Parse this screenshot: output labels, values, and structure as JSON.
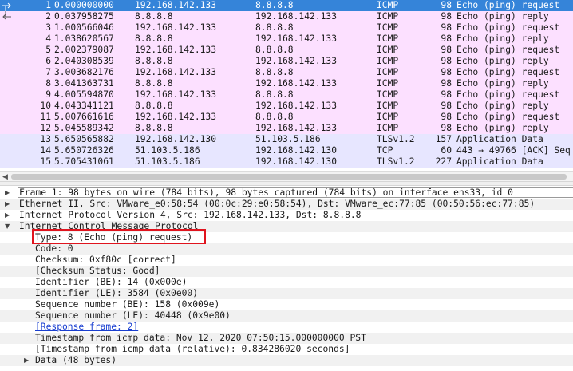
{
  "packets": [
    {
      "no": "1",
      "time": "0.000000000",
      "src": "192.168.142.133",
      "dst": "8.8.8.8",
      "proto": "ICMP",
      "len": "98",
      "info": "Echo (ping) request",
      "kind": "sel"
    },
    {
      "no": "2",
      "time": "0.037958275",
      "src": "8.8.8.8",
      "dst": "192.168.142.133",
      "proto": "ICMP",
      "len": "98",
      "info": "Echo (ping) reply",
      "kind": "icmp"
    },
    {
      "no": "3",
      "time": "1.000566046",
      "src": "192.168.142.133",
      "dst": "8.8.8.8",
      "proto": "ICMP",
      "len": "98",
      "info": "Echo (ping) request",
      "kind": "icmp"
    },
    {
      "no": "4",
      "time": "1.038620567",
      "src": "8.8.8.8",
      "dst": "192.168.142.133",
      "proto": "ICMP",
      "len": "98",
      "info": "Echo (ping) reply",
      "kind": "icmp"
    },
    {
      "no": "5",
      "time": "2.002379087",
      "src": "192.168.142.133",
      "dst": "8.8.8.8",
      "proto": "ICMP",
      "len": "98",
      "info": "Echo (ping) request",
      "kind": "icmp"
    },
    {
      "no": "6",
      "time": "2.040308539",
      "src": "8.8.8.8",
      "dst": "192.168.142.133",
      "proto": "ICMP",
      "len": "98",
      "info": "Echo (ping) reply",
      "kind": "icmp"
    },
    {
      "no": "7",
      "time": "3.003682176",
      "src": "192.168.142.133",
      "dst": "8.8.8.8",
      "proto": "ICMP",
      "len": "98",
      "info": "Echo (ping) request",
      "kind": "icmp"
    },
    {
      "no": "8",
      "time": "3.041363731",
      "src": "8.8.8.8",
      "dst": "192.168.142.133",
      "proto": "ICMP",
      "len": "98",
      "info": "Echo (ping) reply",
      "kind": "icmp"
    },
    {
      "no": "9",
      "time": "4.005594870",
      "src": "192.168.142.133",
      "dst": "8.8.8.8",
      "proto": "ICMP",
      "len": "98",
      "info": "Echo (ping) request",
      "kind": "icmp"
    },
    {
      "no": "10",
      "time": "4.043341121",
      "src": "8.8.8.8",
      "dst": "192.168.142.133",
      "proto": "ICMP",
      "len": "98",
      "info": "Echo (ping) reply",
      "kind": "icmp"
    },
    {
      "no": "11",
      "time": "5.007661616",
      "src": "192.168.142.133",
      "dst": "8.8.8.8",
      "proto": "ICMP",
      "len": "98",
      "info": "Echo (ping) request",
      "kind": "icmp"
    },
    {
      "no": "12",
      "time": "5.045589342",
      "src": "8.8.8.8",
      "dst": "192.168.142.133",
      "proto": "ICMP",
      "len": "98",
      "info": "Echo (ping) reply",
      "kind": "icmp"
    },
    {
      "no": "13",
      "time": "5.650565882",
      "src": "192.168.142.130",
      "dst": "51.103.5.186",
      "proto": "TLSv1.2",
      "len": "157",
      "info": "Application Data",
      "kind": "tcp"
    },
    {
      "no": "14",
      "time": "5.650726326",
      "src": "51.103.5.186",
      "dst": "192.168.142.130",
      "proto": "TCP",
      "len": "60",
      "info": "443 → 49766 [ACK] Seq",
      "kind": "tcp"
    },
    {
      "no": "15",
      "time": "5.705431061",
      "src": "51.103.5.186",
      "dst": "192.168.142.130",
      "proto": "TLSv1.2",
      "len": "227",
      "info": "Application Data",
      "kind": "tcp"
    }
  ],
  "details": [
    {
      "level": 0,
      "expander": "collapsed",
      "text": "Frame 1: 98 bytes on wire (784 bits), 98 bytes captured (784 bits) on interface ens33, id 0"
    },
    {
      "level": 0,
      "expander": "collapsed",
      "text": "Ethernet II, Src: VMware_e0:58:54 (00:0c:29:e0:58:54), Dst: VMware_ec:77:85 (00:50:56:ec:77:85)"
    },
    {
      "level": 0,
      "expander": "collapsed",
      "text": "Internet Protocol Version 4, Src: 192.168.142.133, Dst: 8.8.8.8"
    },
    {
      "level": 0,
      "expander": "expanded",
      "text": "Internet Control Message Protocol"
    },
    {
      "level": 1,
      "expander": "none",
      "text": "Type: 8 (Echo (ping) request)"
    },
    {
      "level": 1,
      "expander": "none",
      "text": "Code: 0"
    },
    {
      "level": 1,
      "expander": "none",
      "text": "Checksum: 0xf80c [correct]"
    },
    {
      "level": 1,
      "expander": "none",
      "text": "[Checksum Status: Good]"
    },
    {
      "level": 1,
      "expander": "none",
      "text": "Identifier (BE): 14 (0x000e)"
    },
    {
      "level": 1,
      "expander": "none",
      "text": "Identifier (LE): 3584 (0x0e00)"
    },
    {
      "level": 1,
      "expander": "none",
      "text": "Sequence number (BE): 158 (0x009e)"
    },
    {
      "level": 1,
      "expander": "none",
      "text": "Sequence number (LE): 40448 (0x9e00)"
    },
    {
      "level": 1,
      "expander": "none",
      "text": "[Response frame: 2]",
      "link": true
    },
    {
      "level": 1,
      "expander": "none",
      "text": "Timestamp from icmp data: Nov 12, 2020 07:50:15.000000000 PST"
    },
    {
      "level": 1,
      "expander": "none",
      "text": "[Timestamp from icmp data (relative): 0.834286020 seconds]"
    },
    {
      "level": 1,
      "expander": "collapsed",
      "text": "Data (48 bytes)"
    }
  ],
  "colors": {
    "selected": "#3584d9",
    "icmp_row": "#fce0ff",
    "tcp_row": "#e7e6ff",
    "highlight_box": "#e0141e",
    "link": "#1a3fd0"
  },
  "icons": {
    "collapsed": "triangle-right-icon",
    "expanded": "triangle-down-icon",
    "request": "request-arrow-icon",
    "reply": "reply-arrow-icon",
    "scroll_left": "scroll-left-icon"
  }
}
